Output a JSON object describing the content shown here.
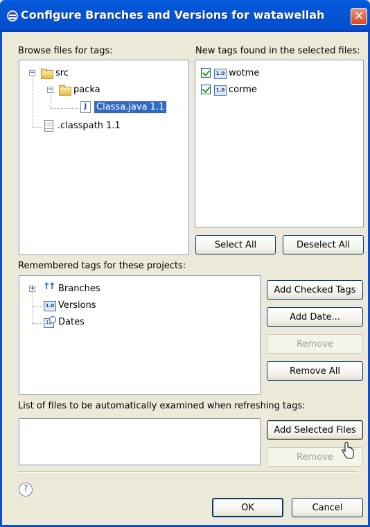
{
  "window": {
    "title": "Configure Branches and Versions for watawellah",
    "close_glyph": "✕"
  },
  "browse": {
    "label": "Browse files for tags:",
    "tree": {
      "src": "src",
      "packa": "packa",
      "classa": "Classa.java 1.1",
      "classpath": ".classpath 1.1"
    }
  },
  "new_tags": {
    "label": "New tags found in the selected files:",
    "items": [
      {
        "label": "wotme",
        "checked": true
      },
      {
        "label": "corme",
        "checked": true
      }
    ],
    "select_all": "Select All",
    "deselect_all": "Deselect All"
  },
  "remembered": {
    "label": "Remembered tags for these projects:",
    "items": [
      "Branches",
      "Versions",
      "Dates"
    ],
    "add_checked": "Add Checked Tags",
    "add_date": "Add Date...",
    "remove": "Remove",
    "remove_all": "Remove All"
  },
  "auto_files": {
    "label": "List of files to be automatically examined when refreshing tags:",
    "add_selected": "Add Selected Files",
    "remove": "Remove"
  },
  "footer": {
    "help": "?",
    "ok": "OK",
    "cancel": "Cancel"
  },
  "colors": {
    "titlebar": "#0454d4",
    "selection": "#316ac5",
    "dialog_bg": "#ece9d8"
  }
}
